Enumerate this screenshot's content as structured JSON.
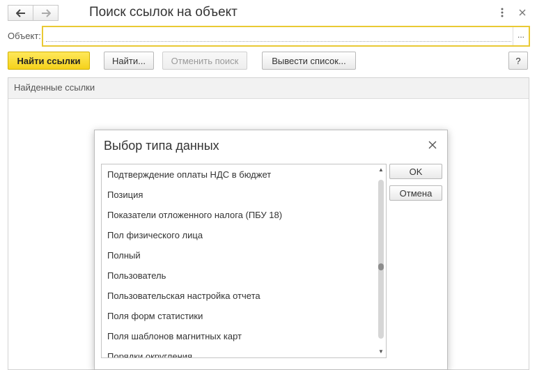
{
  "window": {
    "title": "Поиск ссылок на объект",
    "back_icon": "arrow-left-icon",
    "forward_icon": "arrow-right-icon",
    "menu_icon": "more-vertical-icon",
    "close_icon": "close-icon"
  },
  "object_field": {
    "label": "Объект:",
    "value": "",
    "select_button": "..."
  },
  "toolbar": {
    "find_links": "Найти ссылки",
    "find": "Найти...",
    "cancel_search": "Отменить поиск",
    "output_list": "Вывести список...",
    "help": "?"
  },
  "found_links": {
    "header": "Найденные ссылки"
  },
  "dialog": {
    "title": "Выбор типа данных",
    "ok": "OK",
    "cancel": "Отмена",
    "items": [
      "Подтверждение оплаты НДС в бюджет",
      "Позиция",
      "Показатели отложенного налога (ПБУ 18)",
      "Пол физического лица",
      "Полный",
      "Пользователь",
      "Пользовательская настройка отчета",
      "Поля форм статистики",
      "Поля шаблонов магнитных карт",
      "Порядки округления"
    ],
    "scroll_position": 0.55
  },
  "colors": {
    "accent_yellow": "#f5d21b",
    "field_border": "#e9c934"
  }
}
